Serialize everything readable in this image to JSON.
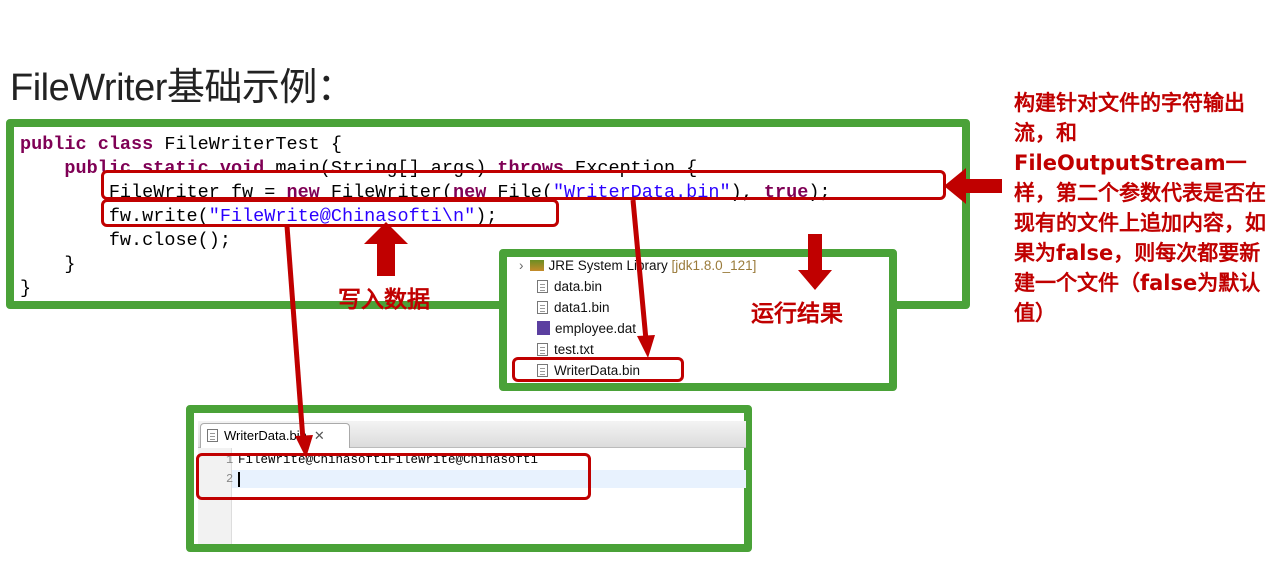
{
  "slide": {
    "title": "FileWriter基础示例："
  },
  "code": {
    "line1": {
      "kw": "public class",
      "rest": " FileWriterTest {"
    },
    "line2": {
      "indent": "    ",
      "kw": "public static void",
      "mid": " main(String[] args) ",
      "kw2": "throws",
      "rest": " Exception {"
    },
    "line3": {
      "indent": "        ",
      "pre": "FileWriter fw = ",
      "kw": "new",
      "mid": " FileWriter(",
      "kw2": "new",
      "mid2": " File(",
      "str": "\"WriterData.bin\"",
      "mid3": "), ",
      "kw3": "true",
      "rest": ");"
    },
    "line4": {
      "indent": "        ",
      "pre": "fw.write(",
      "str": "\"FileWrite@Chinasofti\\n\"",
      "rest": ");"
    },
    "line5": {
      "indent": "        ",
      "text": "fw.close();"
    },
    "line6": {
      "indent": "    ",
      "text": "}"
    },
    "line7": {
      "text": "}"
    }
  },
  "labels": {
    "write_data": "写入数据",
    "run_result": "运行结果"
  },
  "side_note": "构建针对文件的字符输出流，和FileOutputStream一样，第二个参数代表是否在现有的文件上追加内容，如果为false，则每次都要新建一个文件（false为默认值）",
  "explorer": {
    "jre_label": "JRE System Library",
    "jre_version": "[jdk1.8.0_121]",
    "files": [
      "data.bin",
      "data1.bin",
      "employee.dat",
      "test.txt",
      "WriterData.bin"
    ]
  },
  "editor": {
    "tab_label": "WriterData.bin",
    "line_numbers": [
      "1",
      "2"
    ],
    "line1_text": "FileWrite@ChinasoftiFileWrite@Chinasofti",
    "line2_text": ""
  },
  "colors": {
    "accent_green": "#4aa238",
    "accent_red": "#c00000",
    "keyword": "#7f0055",
    "string": "#2a00ff"
  }
}
